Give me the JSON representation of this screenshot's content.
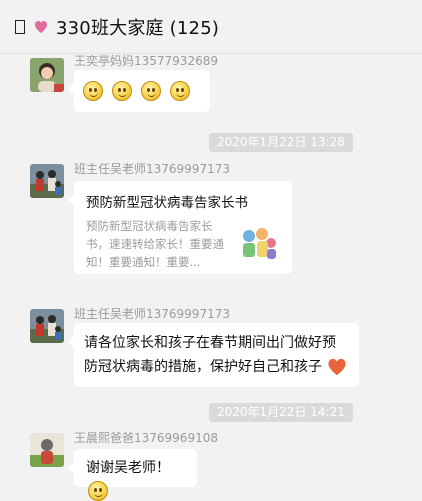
{
  "header": {
    "title": "330班大家庭 (125)"
  },
  "messages": [
    {
      "sender": "王奕亭妈妈13577932689",
      "emoji_count": 4
    },
    {
      "time": "2020年1月22日  13:28"
    },
    {
      "sender": "班主任吴老师13769997173",
      "link": {
        "title": "预防新型冠状病毒告家长书",
        "desc": "预防新型冠状病毒告家长书，速速转给家长！重要通知！重要通知！重要..."
      }
    },
    {
      "sender": "班主任吴老师13769997173",
      "text": "请各位家长和孩子在春节期间出门做好预防冠状病毒的措施，保护好自己和孩子"
    },
    {
      "time": "2020年1月22日  14:21"
    },
    {
      "sender": "王晨熙爸爸13769969108",
      "text": "谢谢吴老师！"
    }
  ],
  "icons": {
    "heart_color": "#e8643a",
    "emoji": "smile-emoji"
  }
}
